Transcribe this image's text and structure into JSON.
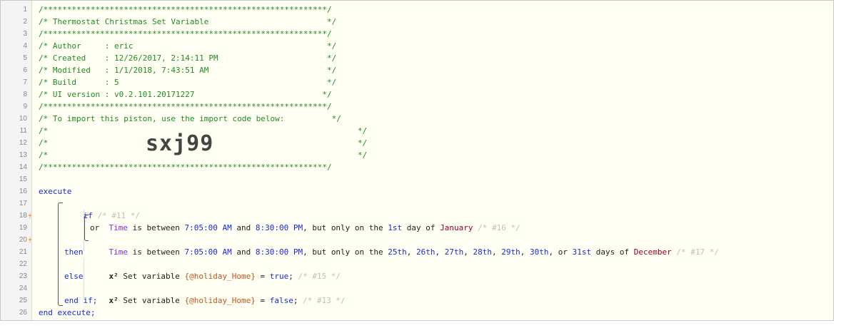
{
  "gutter": {
    "line_numbers": [
      "1",
      "2",
      "3",
      "4",
      "5",
      "6",
      "7",
      "8",
      "9",
      "10",
      "11",
      "12",
      "13",
      "14",
      "15",
      "16",
      "17",
      "18",
      "19",
      "20",
      "21",
      "22",
      "23",
      "24",
      "25",
      "26"
    ],
    "bolt_icon_lines": [
      18,
      20
    ],
    "bolt_color": "#ff9933"
  },
  "header": {
    "border": "/************************************************************/",
    "title": "/* Thermostat Christmas Set Variable                         */",
    "author": "/* Author     : eric                                         */",
    "created": "/* Created    : 12/26/2017, 2:14:11 PM                       */",
    "modified": "/* Modified   : 1/1/2018, 7:43:51 AM                         */",
    "build": "/* Build      : 5                                            */",
    "ui_version": "/* UI version : v0.2.101.20171227                           */",
    "import_hint": "/* To import this piston, use the import code below:          */",
    "blank_start": "/*",
    "blank_end": "*/",
    "import_code": "sxj99"
  },
  "code": {
    "execute": "execute",
    "if": "if",
    "if_ref": "/* #11 */",
    "cond1": {
      "subject": "Time",
      "is_between": "is between",
      "start": "7:05:00 AM",
      "and": "and",
      "end": "8:30:00 PM",
      "but_only": ", but only on the",
      "days": "1st",
      "day_word": "day of",
      "month": "January",
      "ref": "/* #16 */"
    },
    "or": "or",
    "cond2": {
      "subject": "Time",
      "is_between": "is between",
      "start": "7:05:00 AM",
      "and": "and",
      "end": "8:30:00 PM",
      "but_only": ", but only on the",
      "d1": "25th",
      "d2": "26th",
      "d3": "27th",
      "d4": "28th",
      "d5": "29th",
      "d6": "30th",
      "or_word": "or",
      "d7": "31st",
      "day_word": "days of",
      "month": "December",
      "ref": "/* #17 */"
    },
    "then": "then",
    "action1": {
      "x2": "x²",
      "set": "Set variable",
      "var": "{@holiday_Home}",
      "eq": "=",
      "val": "true",
      "semi": ";",
      "ref": "/* #15 */"
    },
    "else": "else",
    "action2": {
      "x2": "x²",
      "set": "Set variable",
      "var": "{@holiday_Home}",
      "eq": "=",
      "val": "false",
      "semi": ";",
      "ref": "/* #13 */"
    },
    "end_if": "end if;",
    "end_execute": "end execute;"
  }
}
